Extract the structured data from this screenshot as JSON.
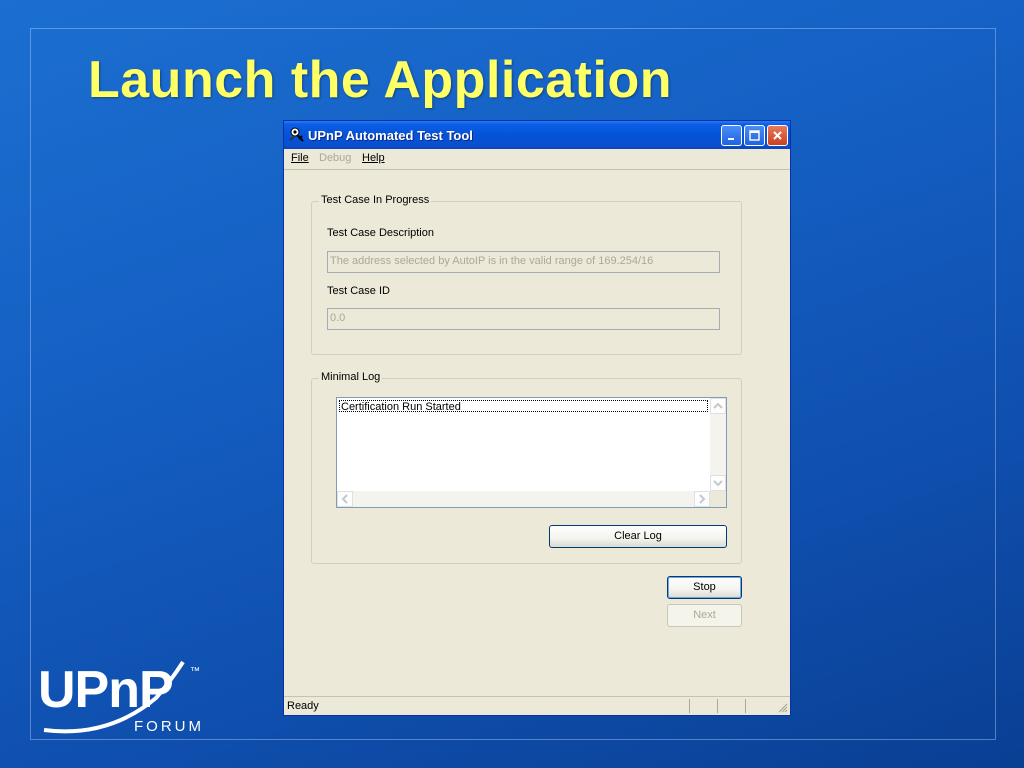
{
  "slide": {
    "title": "Launch the Application"
  },
  "window": {
    "title": "UPnP Automated Test Tool",
    "icon": "app-tool-icon"
  },
  "menu": {
    "file": "File",
    "debug": "Debug",
    "help": "Help"
  },
  "test_case_group": {
    "legend": "Test Case In Progress",
    "description_label": "Test Case Description",
    "description_value": "The address selected by AutoIP is in the valid range of 169.254/16",
    "id_label": "Test Case ID",
    "id_value": "0.0"
  },
  "log_group": {
    "legend": "Minimal Log",
    "entries": [
      "Certification Run Started"
    ],
    "clear_button": "Clear Log"
  },
  "buttons": {
    "stop": "Stop",
    "next": "Next"
  },
  "status": {
    "text": "Ready"
  },
  "logo": {
    "text": "UPnP",
    "sub": "FORUM",
    "tm": "™"
  },
  "colors": {
    "title_yellow": "#ffff66",
    "window_face": "#ece9d8",
    "titlebar_blue": "#0553d8"
  }
}
